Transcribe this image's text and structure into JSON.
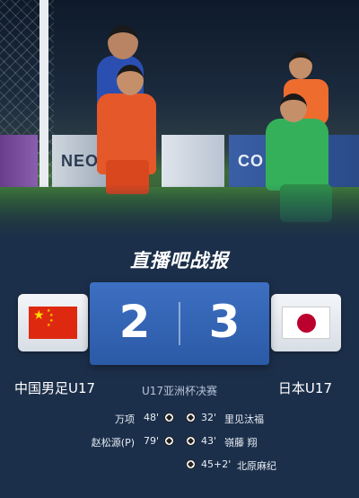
{
  "hero_ads": {
    "board_mid": "NEOM",
    "board_right": "CO"
  },
  "brand": {
    "title": "直播吧战报"
  },
  "match": {
    "home": {
      "name": "中国男足U17",
      "score": "2",
      "flag": "china-flag"
    },
    "away": {
      "name": "日本U17",
      "score": "3",
      "flag": "japan-flag"
    },
    "competition": "U17亚洲杯决赛"
  },
  "goals": {
    "home": [
      {
        "player": "万项",
        "minute": "48'"
      },
      {
        "player": "赵松源(P)",
        "minute": "79'"
      }
    ],
    "away": [
      {
        "minute": "32'",
        "player": "里见汰福"
      },
      {
        "minute": "43'",
        "player": "嶺藤 翔"
      },
      {
        "minute": "45+2'",
        "player": "北原麻纪"
      }
    ]
  },
  "colors": {
    "background": "#1c2f4a",
    "score_panel": "#2f5fa9",
    "muted_text": "#b7c4d8"
  },
  "icons": [
    "soccer-ball-icon"
  ]
}
